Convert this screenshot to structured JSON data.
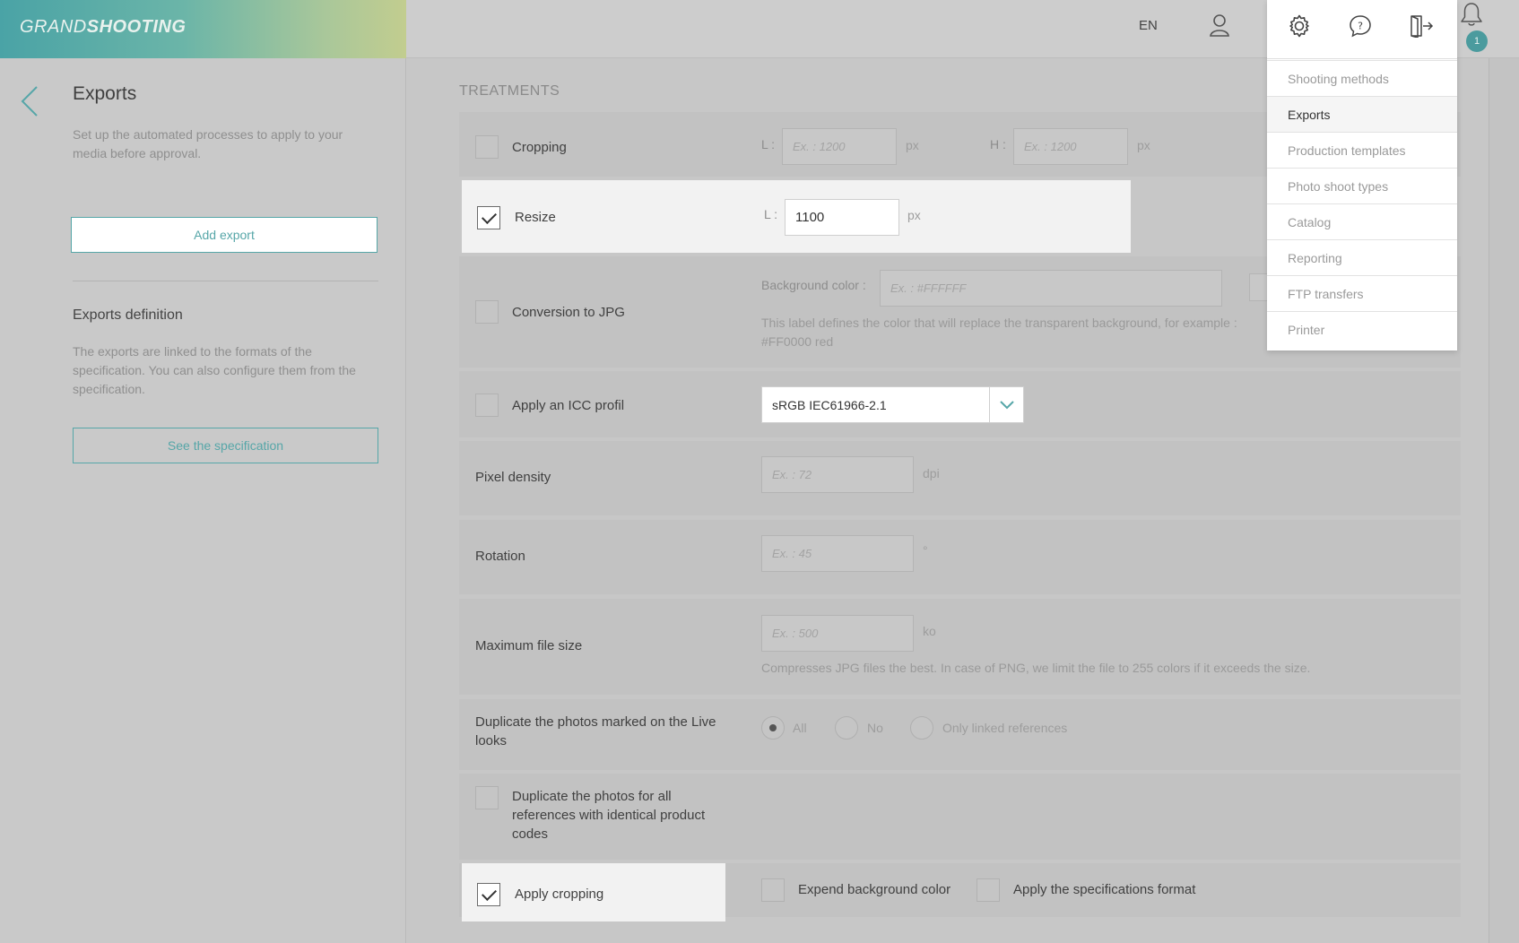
{
  "header": {
    "logo_light": "GRAND",
    "logo_bold": "SHOOTING",
    "language": "EN",
    "notification_count": "1"
  },
  "sidebar": {
    "title": "Exports",
    "description": "Set up the automated processes to apply to your media before approval.",
    "add_export_label": "Add export",
    "definition_title": "Exports definition",
    "definition_description": "The exports are linked to the formats of the specification. You can also configure them from the specification.",
    "see_spec_label": "See the specification"
  },
  "settings_menu": {
    "items": [
      {
        "label": "Shooting methods"
      },
      {
        "label": "Exports"
      },
      {
        "label": "Production templates"
      },
      {
        "label": "Photo shoot types"
      },
      {
        "label": "Catalog"
      },
      {
        "label": "Reporting"
      },
      {
        "label": "FTP transfers"
      },
      {
        "label": "Printer"
      }
    ],
    "active": "Exports"
  },
  "treatments": {
    "section_title": "TREATMENTS",
    "cropping": {
      "label": "Cropping",
      "checked": false,
      "l_label": "L :",
      "l_placeholder": "Ex. : 1200",
      "l_unit": "px",
      "h_label": "H :",
      "h_placeholder": "Ex. : 1200",
      "h_unit": "px"
    },
    "resize": {
      "label": "Resize",
      "checked": true,
      "l_label": "L :",
      "l_value": "1100",
      "l_unit": "px"
    },
    "jpg": {
      "label": "Conversion to JPG",
      "checked": false,
      "bg_label": "Background color :",
      "bg_placeholder": "Ex. : #FFFFFF",
      "hint_line1": "This label defines the color that will replace the transparent background, for example :",
      "hint_line2": "#FF0000 red"
    },
    "icc": {
      "label": "Apply an ICC profil",
      "checked": false,
      "selected": "sRGB IEC61966-2.1"
    },
    "pixel_density": {
      "label": "Pixel density",
      "placeholder": "Ex. : 72",
      "unit": "dpi"
    },
    "rotation": {
      "label": "Rotation",
      "placeholder": "Ex. : 45",
      "unit": "°"
    },
    "max_file_size": {
      "label": "Maximum file size",
      "placeholder": "Ex. : 500",
      "unit": "ko",
      "hint": "Compresses JPG files the best. In case of PNG, we limit the file to 255 colors if it exceeds the size."
    },
    "duplicate_live": {
      "label": "Duplicate the photos marked on the Live looks",
      "options": [
        "All",
        "No",
        "Only linked references"
      ],
      "selected": "All"
    },
    "duplicate_refs": {
      "label": "Duplicate the photos for all references with identical product codes",
      "checked": false
    },
    "apply_cropping": {
      "label": "Apply cropping",
      "checked": true,
      "expend_label": "Expend background color",
      "expend_checked": false,
      "spec_label": "Apply the specifications format",
      "spec_checked": false
    }
  },
  "colors": {
    "accent": "#56a6a8",
    "badge": "#4b9b9e"
  }
}
